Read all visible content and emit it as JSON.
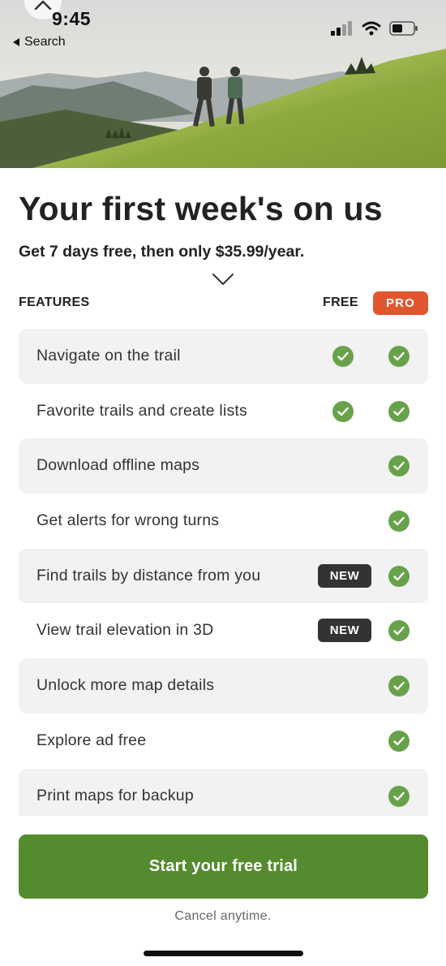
{
  "status_bar": {
    "time": "9:45",
    "back_label": "Search"
  },
  "header": {
    "title": "Your first week's on us",
    "subtitle": "Get 7 days free, then only $35.99/year."
  },
  "features_table": {
    "column_label": "FEATURES",
    "free_label": "FREE",
    "pro_label": "PRO",
    "rows": [
      {
        "label": "Navigate on the trail",
        "free": true,
        "pro": true,
        "badge": ""
      },
      {
        "label": "Favorite trails and create lists",
        "free": true,
        "pro": true,
        "badge": ""
      },
      {
        "label": "Download offline maps",
        "free": false,
        "pro": true,
        "badge": ""
      },
      {
        "label": "Get alerts for wrong turns",
        "free": false,
        "pro": true,
        "badge": ""
      },
      {
        "label": "Find trails by distance from you",
        "free": false,
        "pro": true,
        "badge": "NEW"
      },
      {
        "label": "View trail elevation in 3D",
        "free": false,
        "pro": true,
        "badge": "NEW"
      },
      {
        "label": "Unlock more map details",
        "free": false,
        "pro": true,
        "badge": ""
      },
      {
        "label": "Explore ad free",
        "free": false,
        "pro": true,
        "badge": ""
      },
      {
        "label": "Print maps for backup",
        "free": false,
        "pro": true,
        "badge": ""
      }
    ]
  },
  "cta": {
    "button_label": "Start your free trial",
    "note": "Cancel anytime."
  },
  "colors": {
    "pro_badge": "#e0562e",
    "check": "#67a24a",
    "cta_button": "#558b2f",
    "new_badge": "#333333",
    "row_shade": "#f2f2f2"
  },
  "icons": {
    "back": "back-triangle-icon",
    "close": "chevron-up-icon",
    "signal": "cellular-signal-icon",
    "wifi": "wifi-icon",
    "battery": "battery-icon",
    "expand": "chevron-down-icon",
    "check": "checkmark-icon"
  }
}
